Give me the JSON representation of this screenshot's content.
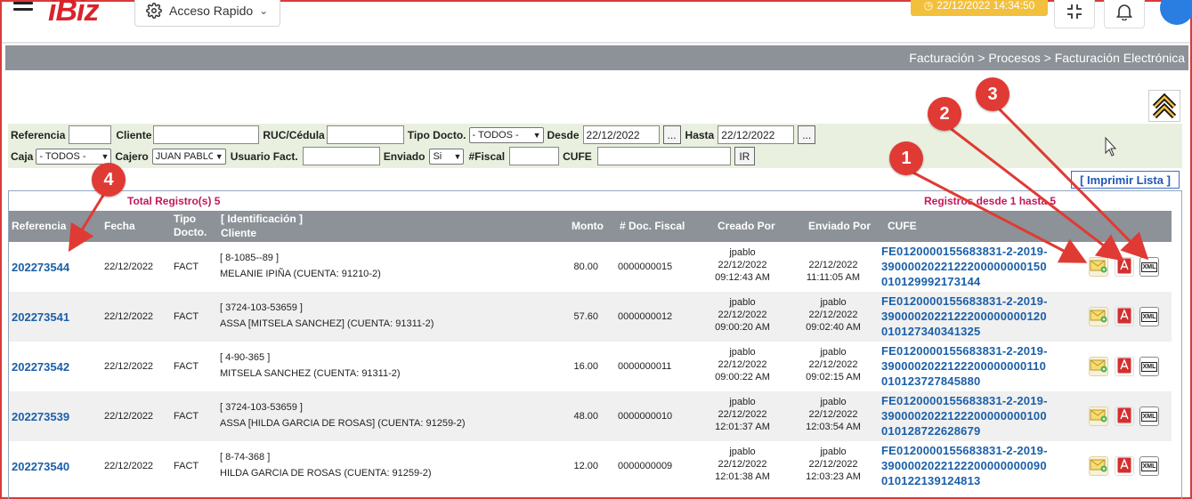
{
  "header": {
    "logo": "iBiz",
    "quick_access_label": "Acceso Rapido",
    "datetime": "22/12/2022 14:34:50"
  },
  "breadcrumb": "Facturación > Procesos > Facturación Electrónica",
  "filters": {
    "referencia_label": "Referencia",
    "cliente_label": "Cliente",
    "ruc_label": "RUC/Cédula",
    "tipo_docto_label": "Tipo Docto.",
    "tipo_docto_value": "- TODOS -",
    "desde_label": "Desde",
    "desde_value": "22/12/2022",
    "hasta_label": "Hasta",
    "hasta_value": "22/12/2022",
    "date_picker_label": "...",
    "caja_label": "Caja",
    "caja_value": "- TODOS -",
    "cajero_label": "Cajero",
    "cajero_value": "JUAN PABLO",
    "usuario_fact_label": "Usuario Fact.",
    "enviado_label": "Enviado",
    "enviado_value": "Si",
    "fiscal_label": "#Fiscal",
    "cufe_label": "CUFE",
    "go_button": "IR"
  },
  "print_list": "[ Imprimir Lista ]",
  "results": {
    "total": "Total Registro(s) 5",
    "range": "Registros desde 1 hasta 5",
    "headers": {
      "referencia": "Referencia",
      "fecha": "Fecha",
      "tipo_docto": "Tipo Docto.",
      "identificacion": "[ Identificación ]",
      "cliente": "Cliente",
      "monto": "Monto",
      "doc_fiscal": "# Doc. Fiscal",
      "creado_por": "Creado Por",
      "enviado_por": "Enviado Por",
      "cufe": "CUFE"
    },
    "rows": [
      {
        "ref": "202273544",
        "fecha": "22/12/2022",
        "tipo": "FACT",
        "ident": "[ 8-1085--89 ]",
        "cliente": "MELANIE IPIÑA (CUENTA: 91210-2)",
        "monto": "80.00",
        "fiscal": "0000000015",
        "creado_user": "jpablo",
        "creado_date": "22/12/2022",
        "creado_time": "09:12:43 AM",
        "enviado_user": "",
        "enviado_date": "22/12/2022",
        "enviado_time": "11:11:05 AM",
        "cufe1": "FE0120000155683831-2-2019-",
        "cufe2": "3900002022122200000000150",
        "cufe3": "010129992173144"
      },
      {
        "ref": "202273541",
        "fecha": "22/12/2022",
        "tipo": "FACT",
        "ident": "[ 3724-103-53659 ]",
        "cliente": "ASSA [MITSELA SANCHEZ] (CUENTA: 91311-2)",
        "monto": "57.60",
        "fiscal": "0000000012",
        "creado_user": "jpablo",
        "creado_date": "22/12/2022",
        "creado_time": "09:00:20 AM",
        "enviado_user": "jpablo",
        "enviado_date": "22/12/2022",
        "enviado_time": "09:02:40 AM",
        "cufe1": "FE0120000155683831-2-2019-",
        "cufe2": "3900002022122200000000120",
        "cufe3": "010127340341325"
      },
      {
        "ref": "202273542",
        "fecha": "22/12/2022",
        "tipo": "FACT",
        "ident": "[ 4-90-365 ]",
        "cliente": "MITSELA SANCHEZ (CUENTA: 91311-2)",
        "monto": "16.00",
        "fiscal": "0000000011",
        "creado_user": "jpablo",
        "creado_date": "22/12/2022",
        "creado_time": "09:00:22 AM",
        "enviado_user": "jpablo",
        "enviado_date": "22/12/2022",
        "enviado_time": "09:02:15 AM",
        "cufe1": "FE0120000155683831-2-2019-",
        "cufe2": "3900002022122200000000110",
        "cufe3": "010123727845880"
      },
      {
        "ref": "202273539",
        "fecha": "22/12/2022",
        "tipo": "FACT",
        "ident": "[ 3724-103-53659 ]",
        "cliente": "ASSA [HILDA GARCIA DE ROSAS] (CUENTA: 91259-2)",
        "monto": "48.00",
        "fiscal": "0000000010",
        "creado_user": "jpablo",
        "creado_date": "22/12/2022",
        "creado_time": "12:01:37 AM",
        "enviado_user": "jpablo",
        "enviado_date": "22/12/2022",
        "enviado_time": "12:03:54 AM",
        "cufe1": "FE0120000155683831-2-2019-",
        "cufe2": "3900002022122200000000100",
        "cufe3": "010128722628679"
      },
      {
        "ref": "202273540",
        "fecha": "22/12/2022",
        "tipo": "FACT",
        "ident": "[ 8-74-368 ]",
        "cliente": "HILDA GARCIA DE ROSAS (CUENTA: 91259-2)",
        "monto": "12.00",
        "fiscal": "0000000009",
        "creado_user": "jpablo",
        "creado_date": "22/12/2022",
        "creado_time": "12:01:38 AM",
        "enviado_user": "jpablo",
        "enviado_date": "22/12/2022",
        "enviado_time": "12:03:23 AM",
        "cufe1": "FE0120000155683831-2-2019-",
        "cufe2": "3900002022122200000000090",
        "cufe3": "010122139124813"
      }
    ],
    "actions": {
      "email_icon": "email-send-icon",
      "pdf_icon": "pdf-icon",
      "xml_label": "XML"
    }
  },
  "callouts": [
    "1",
    "2",
    "3",
    "4"
  ],
  "colors": {
    "accent_red": "#e03a34",
    "header_gray": "#8c9298",
    "link_blue": "#1b5fa8",
    "badge_yellow": "#f2c03c"
  }
}
